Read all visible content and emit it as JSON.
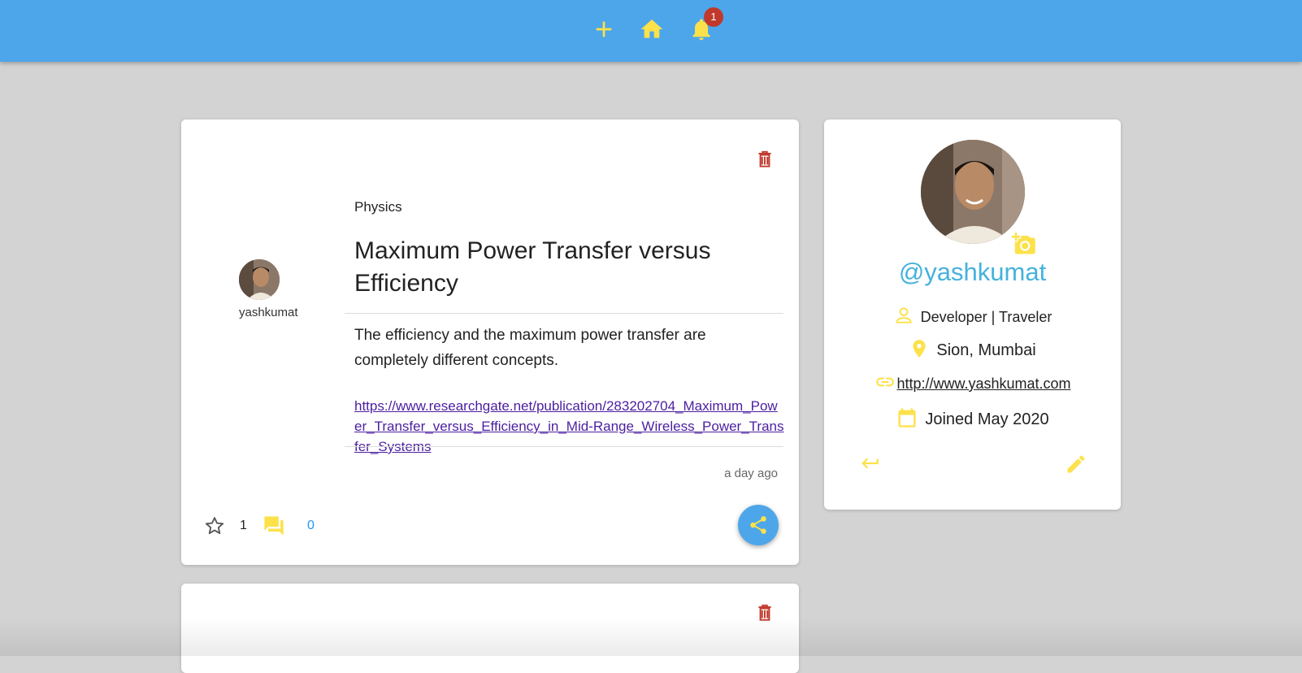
{
  "colors": {
    "topbar": "#4da6ea",
    "accent_yellow": "#fde14a",
    "delete_red": "#c0392b",
    "link_blue": "#45b2dc",
    "comment_count": "#2196f3"
  },
  "navbar": {
    "icons": [
      "plus-icon",
      "home-icon",
      "bell-icon"
    ],
    "notification_count": "1"
  },
  "post": {
    "category": "Physics",
    "title": "Maximum Power Transfer versus Efficiency",
    "body": "The efficiency and the maximum power transfer are completely different concepts.",
    "link": "https://www.researchgate.net/publication/283202704_Maximum_Power_Transfer_versus_Efficiency_in_Mid-Range_Wireless_Power_Transfer_Systems",
    "author": "yashkumat",
    "time_ago": "a day ago",
    "likes": "1",
    "comments": "0"
  },
  "profile": {
    "handle": "@yashkumat",
    "bio": "Developer | Traveler",
    "location": "Sion, Mumbai",
    "website": " http://www.yashkumat.com",
    "joined": "Joined May 2020"
  }
}
